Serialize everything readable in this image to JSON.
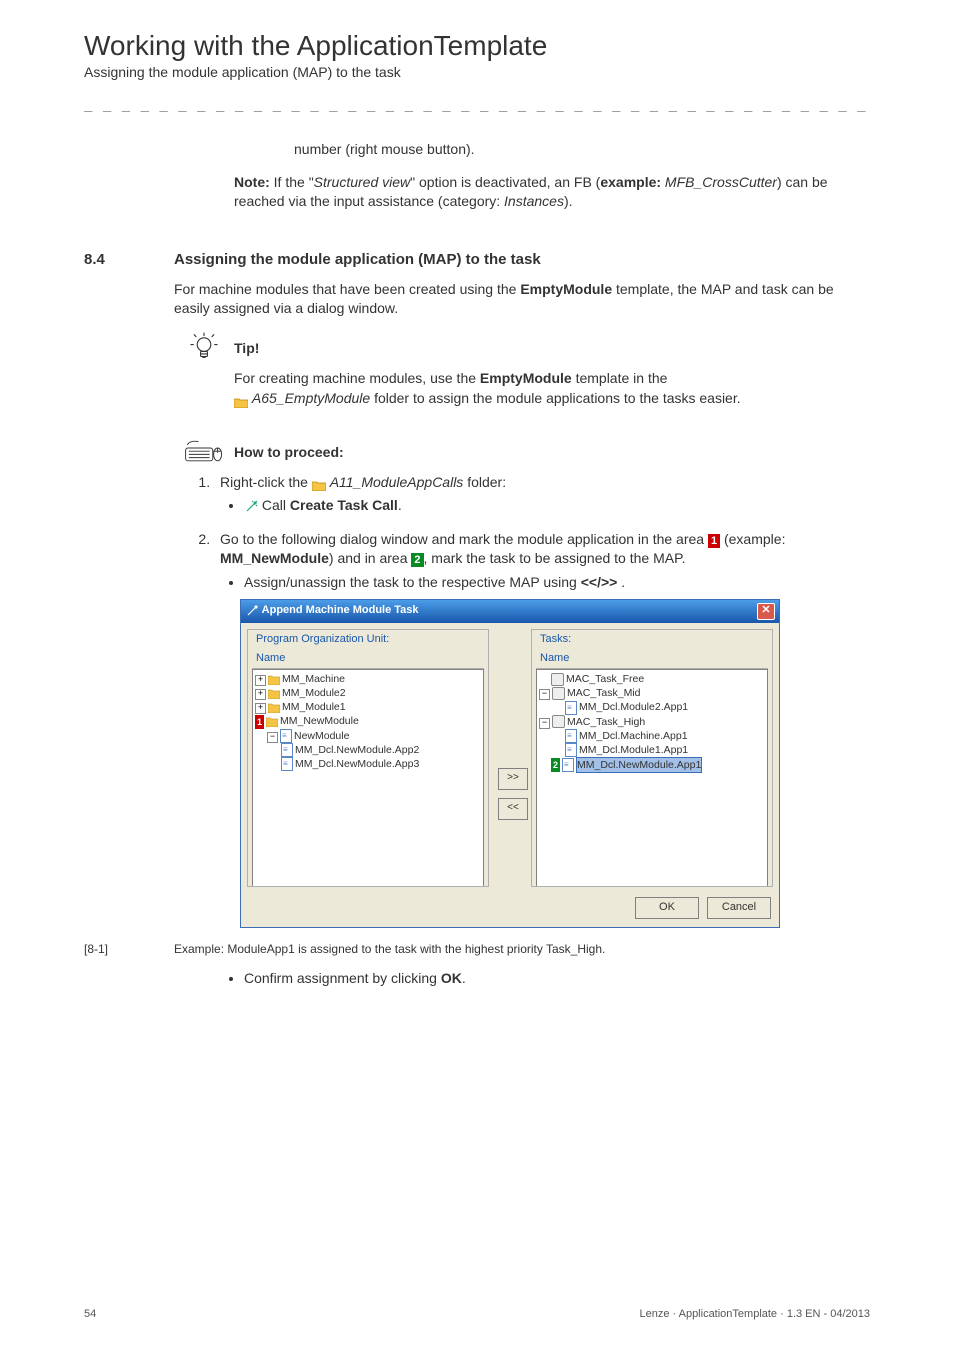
{
  "header": {
    "title": "Working with the ApplicationTemplate",
    "subtitle": "Assigning the module application (MAP) to the task"
  },
  "intro_fragment": {
    "line1": "number (right mouse button).",
    "note_label": "Note:",
    "note_text_a": " If the \"",
    "note_text_b": "Structured view",
    "note_text_c": "\" option is deactivated, an FB (",
    "note_text_d": "example:",
    "note_text_e": " MFB_CrossCutter",
    "note_text_f": ") can be reached via the input assistance (category: ",
    "note_text_g": "Instances",
    "note_text_h": ")."
  },
  "section": {
    "number": "8.4",
    "title": "Assigning the module application (MAP) to the task",
    "para1_a": "For machine modules that have been created using the ",
    "para1_b": "EmptyModule",
    "para1_c": " template, the MAP and task can be easily assigned via a dialog window."
  },
  "tip": {
    "label": "Tip!",
    "line_a": "For creating machine modules, use the ",
    "line_b": "EmptyModule",
    "line_c": " template in the ",
    "line_d": "A65_EmptyModule",
    "line_e": " folder to assign the module applications to the tasks easier."
  },
  "howto": {
    "label": "How to proceed:"
  },
  "steps": {
    "s1_a": "Right-click the ",
    "s1_b": "A11_ModuleAppCalls",
    "s1_c": " folder:",
    "s1_sub_a": "Call ",
    "s1_sub_b": "Create Task Call",
    "s1_sub_c": ".",
    "s2_a": "Go to the following dialog window and mark the module application in the area ",
    "s2_b": " (example: ",
    "s2_c": "MM_NewModule",
    "s2_d": ") and in area ",
    "s2_e": ", mark the task to be assigned to the MAP.",
    "s2_sub1_a": "Assign/unassign the task to the respective MAP using ",
    "s2_sub1_b": "<</>> ",
    "s2_sub1_c": ".",
    "s2_sub2": "Confirm assignment by clicking ",
    "s2_sub2_b": "OK",
    "s2_sub2_c": "."
  },
  "dialog": {
    "title": "Append Machine Module Task",
    "left_legend": "Program Organization Unit:",
    "right_legend": "Tasks:",
    "col_name": "Name",
    "assign": ">>",
    "unassign": "<<",
    "ok": "OK",
    "cancel": "Cancel",
    "left_tree": {
      "i0": "MM_Machine",
      "i1": "MM_Module2",
      "i2": "MM_Module1",
      "i3": "MM_NewModule",
      "i4": "NewModule",
      "i5": "MM_Dcl.NewModule.App2",
      "i6": "MM_Dcl.NewModule.App3"
    },
    "right_tree": {
      "r0": "MAC_Task_Free",
      "r1": "MAC_Task_Mid",
      "r2": "MM_Dcl.Module2.App1",
      "r3": "MAC_Task_High",
      "r4": "MM_Dcl.Machine.App1",
      "r5": "MM_Dcl.Module1.App1",
      "r6": "MM_Dcl.NewModule.App1"
    },
    "badge1": "1",
    "badge2": "2"
  },
  "figure": {
    "num": "[8-1]",
    "caption": "Example: ModuleApp1 is assigned to the task with the highest priority Task_High."
  },
  "footer": {
    "page": "54",
    "doc": "Lenze · ApplicationTemplate · 1.3 EN - 04/2013"
  }
}
